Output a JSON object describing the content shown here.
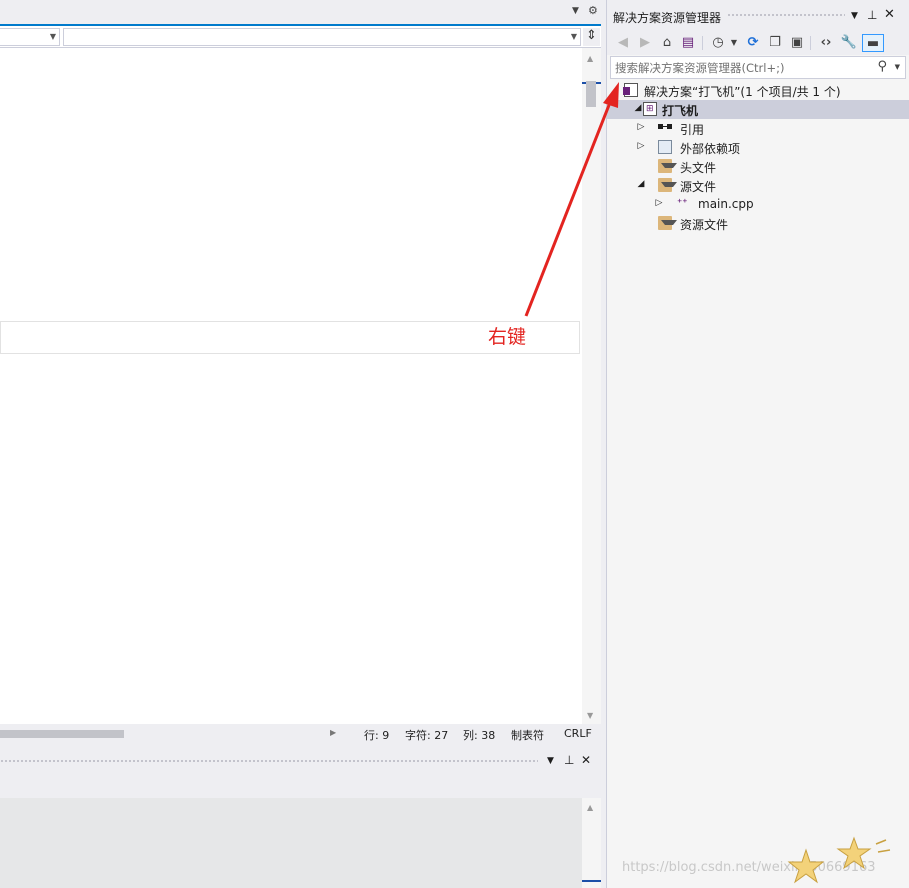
{
  "editor": {
    "status": {
      "line": "行: 9",
      "char": "字符: 27",
      "col": "列: 38",
      "tabs": "制表符",
      "eol": "CRLF"
    }
  },
  "solution_explorer": {
    "title": "解决方案资源管理器",
    "search_placeholder": "搜索解决方案资源管理器(Ctrl+;)",
    "tree": {
      "solution": "解决方案“打飞机”(1 个项目/共 1 个)",
      "project": "打飞机",
      "references": "引用",
      "external_deps": "外部依赖项",
      "header_files": "头文件",
      "source_files": "源文件",
      "main_cpp": "main.cpp",
      "resource_files": "资源文件"
    }
  },
  "annotation": {
    "text": "右键",
    "color": "#e32420"
  },
  "watermark": "https://blog.csdn.net/weixin_50669163",
  "icons": {
    "back": "back-arrow-icon",
    "forward": "forward-arrow-icon",
    "home": "home-icon",
    "switch_views": "switch-views-icon",
    "pending_changes": "pending-changes-filter-icon",
    "sync": "sync-icon",
    "collapse_all": "collapse-all-icon",
    "show_all_files": "show-all-files-icon",
    "view_code": "view-code-icon",
    "properties": "wrench-icon",
    "preview": "preview-selected-icon"
  }
}
